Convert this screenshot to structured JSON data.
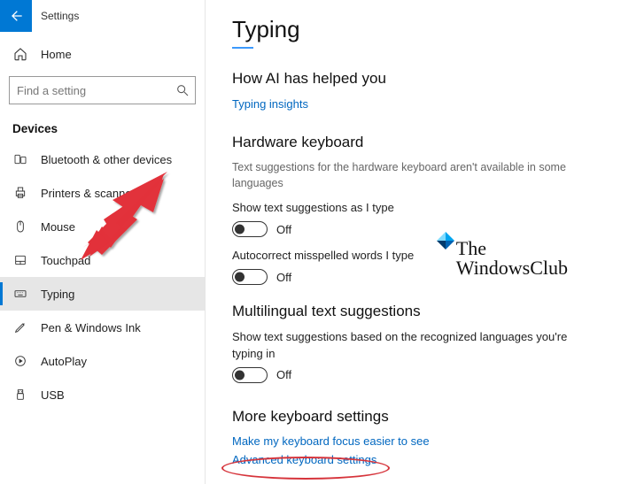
{
  "header": {
    "app_title": "Settings"
  },
  "sidebar": {
    "home_label": "Home",
    "search_placeholder": "Find a setting",
    "category_label": "Devices",
    "items": [
      {
        "label": "Bluetooth & other devices",
        "icon": "bluetooth-devices-icon"
      },
      {
        "label": "Printers & scanners",
        "icon": "printer-icon"
      },
      {
        "label": "Mouse",
        "icon": "mouse-icon"
      },
      {
        "label": "Touchpad",
        "icon": "touchpad-icon"
      },
      {
        "label": "Typing",
        "icon": "keyboard-icon",
        "selected": true
      },
      {
        "label": "Pen & Windows Ink",
        "icon": "pen-icon"
      },
      {
        "label": "AutoPlay",
        "icon": "autoplay-icon"
      },
      {
        "label": "USB",
        "icon": "usb-icon"
      }
    ]
  },
  "content": {
    "page_title": "Typing",
    "sections": {
      "ai": {
        "heading": "How AI has helped you",
        "link": "Typing insights"
      },
      "hardware": {
        "heading": "Hardware keyboard",
        "description": "Text suggestions for the hardware keyboard aren't available in some languages",
        "setting1_label": "Show text suggestions as I type",
        "setting1_state": "Off",
        "setting2_label": "Autocorrect misspelled words I type",
        "setting2_state": "Off"
      },
      "multilingual": {
        "heading": "Multilingual text suggestions",
        "setting_label": "Show text suggestions based on the recognized languages you're typing in",
        "setting_state": "Off"
      },
      "more": {
        "heading": "More keyboard settings",
        "link1": "Make my keyboard focus easier to see",
        "link2": "Advanced keyboard settings"
      }
    }
  },
  "watermark": {
    "line1": "The",
    "line2": "WindowsClub"
  }
}
